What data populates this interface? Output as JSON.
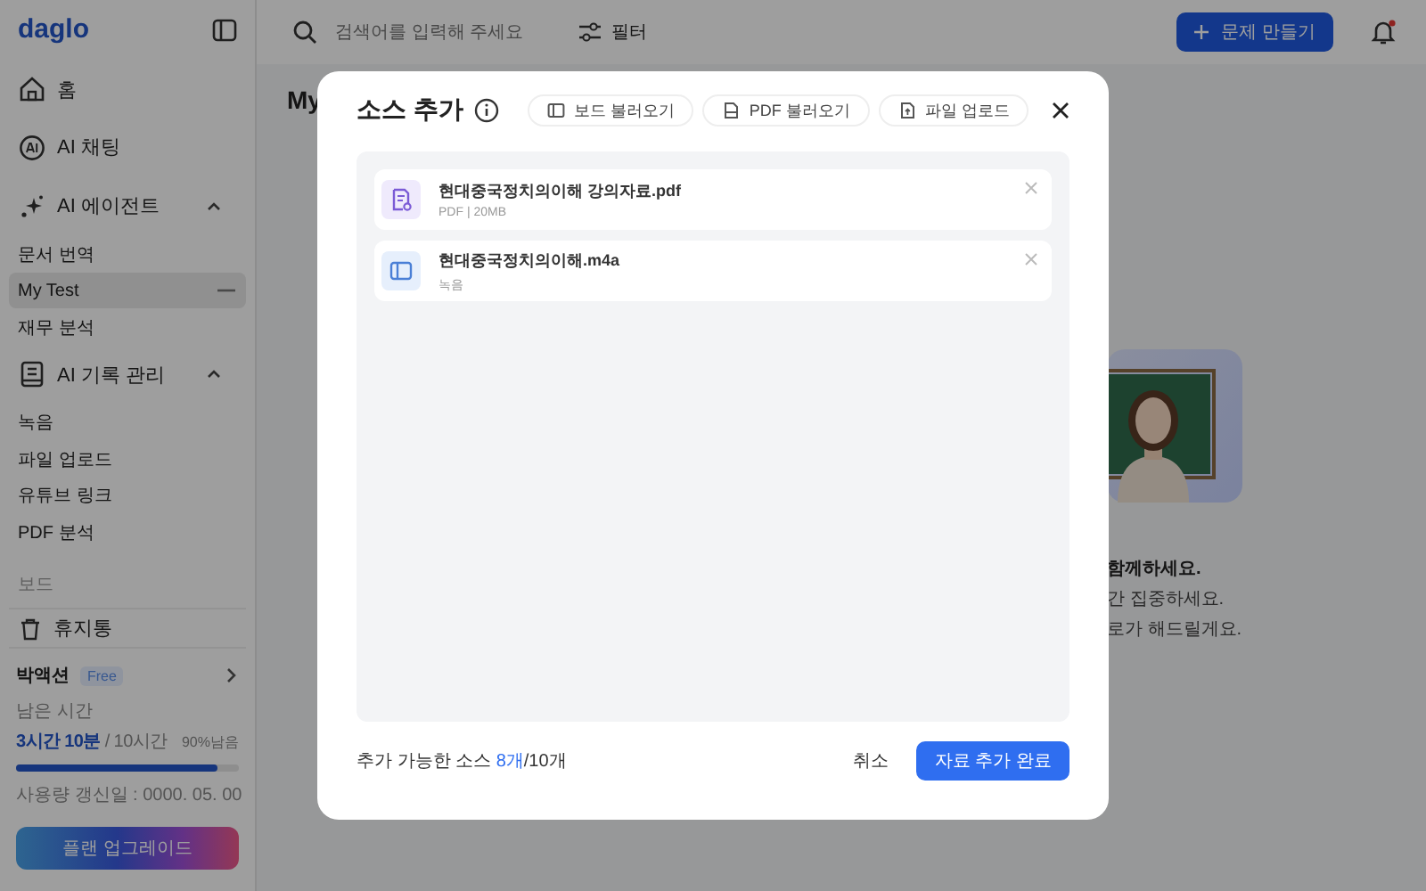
{
  "sidebar": {
    "logo": "daglo",
    "nav": [
      {
        "label": "홈"
      },
      {
        "label": "AI 채팅"
      },
      {
        "label": "AI 에이전트",
        "expanded": true,
        "children": [
          {
            "label": "문서 번역",
            "selected": false
          },
          {
            "label": "My Test",
            "selected": true
          },
          {
            "label": "재무 분석",
            "selected": false
          }
        ]
      },
      {
        "label": "AI 기록 관리",
        "expanded": true,
        "children": [
          {
            "label": "녹음",
            "selected": false
          },
          {
            "label": "파일 업로드",
            "selected": false
          },
          {
            "label": "유튜브 링크",
            "selected": false
          },
          {
            "label": "PDF 분석",
            "selected": false
          }
        ]
      }
    ],
    "board": {
      "label": "보드",
      "items": [
        {
          "label": "휴지통"
        }
      ]
    },
    "account": {
      "name": "박액션",
      "plan": "Free",
      "remaining_label": "남은 시간",
      "used": "3시간 10분",
      "total": "/ 10시간",
      "percent": "90%남음",
      "level": 0.9,
      "renewal": "사용량 갱신일 : 0000. 05. 00",
      "upgrade": "플랜 업그레이드"
    }
  },
  "topbar": {
    "search": {
      "placeholder": "검색어를 입력해 주세요"
    },
    "filter": "필터",
    "create": "문제 만들기"
  },
  "page": {
    "title": "My",
    "lines": [
      "함께하세요.",
      "간 집중하세요.",
      "로가 해드릴게요."
    ]
  },
  "modal": {
    "title": "소스 추가",
    "sources": [
      "보드 불러오기",
      "PDF 불러오기",
      "파일 업로드"
    ],
    "files": [
      {
        "kind": "pdf",
        "name": "현대중국정치의이해 강의자료.pdf",
        "meta": "PDF | 20MB"
      },
      {
        "kind": "audio",
        "name": "현대중국정치의이해.m4a",
        "meta": "녹음"
      }
    ],
    "count": {
      "label": "추가 가능한 소스",
      "available": "8개",
      "limit": "/10개"
    },
    "cancel": "취소",
    "confirm": "자료 추가 완료"
  }
}
